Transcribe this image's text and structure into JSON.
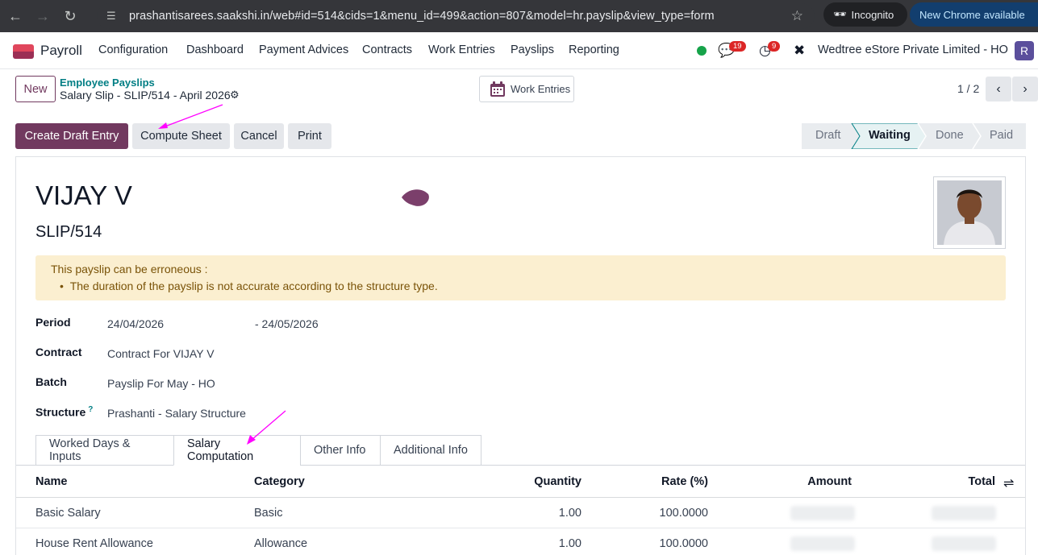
{
  "browser": {
    "url": "prashantisarees.saakshi.in/web#id=514&cids=1&menu_id=499&action=807&model=hr.payslip&view_type=form",
    "incognito_label": "Incognito",
    "update_label": "New Chrome available"
  },
  "navbar": {
    "app_name": "Payroll",
    "menu": [
      "Configuration",
      "Dashboard",
      "Payment Advices",
      "Contracts",
      "Work Entries",
      "Payslips",
      "Reporting"
    ],
    "messages_count": "19",
    "activities_count": "9",
    "company": "Wedtree eStore Private Limited - HO",
    "user_initial": "R",
    "accent": "#71395f"
  },
  "control": {
    "new_label": "New",
    "breadcrumb_parent": "Employee Payslips",
    "breadcrumb_current": "Salary Slip - SLIP/514 - April 2026",
    "work_entries_label": "Work Entries",
    "pager": "1 / 2"
  },
  "actions": {
    "create_draft": "Create Draft Entry",
    "compute": "Compute Sheet",
    "cancel": "Cancel",
    "print": "Print"
  },
  "status": {
    "stages": [
      "Draft",
      "Waiting",
      "Done",
      "Paid"
    ],
    "active": "Waiting"
  },
  "form": {
    "employee": "VIJAY V",
    "slip_number": "SLIP/514",
    "warning_title": "This payslip can be erroneous :",
    "warning_item": "The duration of the payslip is not accurate according to the structure type.",
    "period_label": "Period",
    "period_from": "24/04/2026",
    "period_to": "- 24/05/2026",
    "contract_label": "Contract",
    "contract": "Contract For VIJAY V",
    "batch_label": "Batch",
    "batch": "Payslip For May - HO",
    "structure_label": "Structure",
    "structure_help": "?",
    "structure": "Prashanti - Salary Structure"
  },
  "tabs": [
    "Worked Days & Inputs",
    "Salary Computation",
    "Other Info",
    "Additional Info"
  ],
  "table": {
    "headers": [
      "Name",
      "Category",
      "Quantity",
      "Rate (%)",
      "Amount",
      "Total"
    ],
    "rows": [
      {
        "name": "Basic Salary",
        "category": "Basic",
        "quantity": "1.00",
        "rate": "100.0000"
      },
      {
        "name": "House Rent Allowance",
        "category": "Allowance",
        "quantity": "1.00",
        "rate": "100.0000"
      }
    ]
  }
}
